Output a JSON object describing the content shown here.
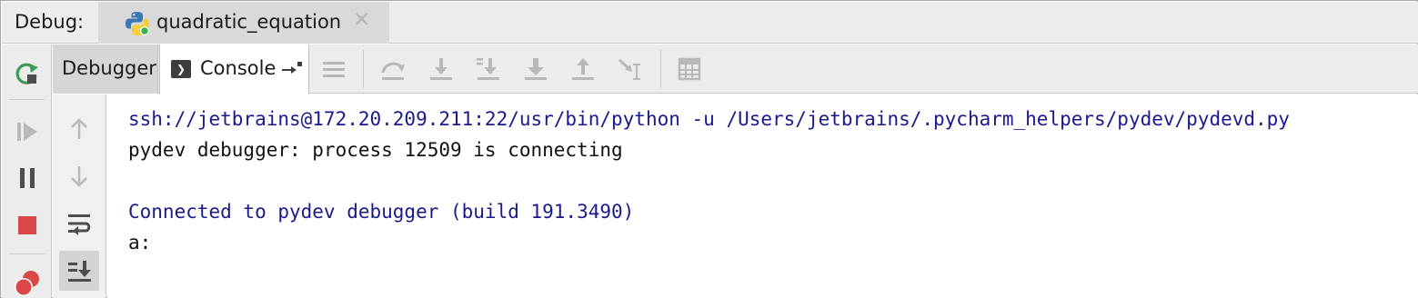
{
  "window": {
    "debug_label": "Debug:",
    "run_tab": {
      "title": "quadratic_equation",
      "icon": "python-icon",
      "close_icon": "close-icon"
    }
  },
  "left_strip": {
    "buttons": [
      {
        "name": "rerun-icon",
        "color": "#3d9b54"
      },
      {
        "name": "resume-icon",
        "color": "#b8b8b8"
      },
      {
        "name": "pause-icon",
        "color": "#4d4d4d"
      },
      {
        "name": "stop-icon",
        "color": "#db4848"
      },
      {
        "name": "view-breakpoints-icon",
        "color": "#db4848"
      }
    ]
  },
  "tabs": {
    "debugger_label": "Debugger",
    "console_label": "Console",
    "console_icon": "console-icon",
    "pin_icon": "restore-layout-icon"
  },
  "toolbar": {
    "icons": [
      "show-execution-point-icon",
      "step-over-icon",
      "step-into-icon",
      "step-into-my-code-icon",
      "force-step-into-icon",
      "step-out-icon",
      "run-to-cursor-icon",
      "evaluate-expression-icon"
    ]
  },
  "gutter": {
    "icons": [
      "up-arrow-icon",
      "down-arrow-icon",
      "soft-wrap-icon",
      "scroll-to-end-icon"
    ]
  },
  "console": {
    "lines": [
      {
        "text": "ssh://jetbrains@172.20.209.211:22/usr/bin/python -u /Users/jetbrains/.pycharm_helpers/pydev/pydevd.py",
        "kind": "sys"
      },
      {
        "text": "pydev debugger: process 12509 is connecting",
        "kind": "out"
      },
      {
        "text": "",
        "kind": "out"
      },
      {
        "text": "Connected to pydev debugger (build 191.3490)",
        "kind": "sys"
      },
      {
        "text": "a:",
        "kind": "out"
      }
    ],
    "colors": {
      "system": "#1a1a8c",
      "stdout": "#111111"
    }
  }
}
